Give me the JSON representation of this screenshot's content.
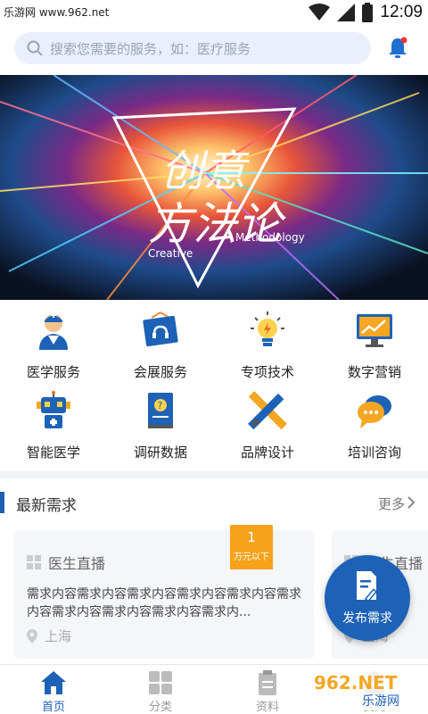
{
  "statusbar": {
    "watermark": "乐游网 www.962.net",
    "time": "12:09"
  },
  "search": {
    "placeholder": "搜索您需要的服务，如：医疗服务"
  },
  "banner": {
    "title_line1": "创意",
    "title_line2": "方法论",
    "sub_left": "Creative",
    "sub_right": "Methodology"
  },
  "categories": [
    {
      "label": "医学服务",
      "icon": "doctor-icon"
    },
    {
      "label": "会展服务",
      "icon": "exhibition-sign-icon"
    },
    {
      "label": "专项技术",
      "icon": "lightbulb-icon"
    },
    {
      "label": "数字营销",
      "icon": "monitor-chart-icon"
    },
    {
      "label": "智能医学",
      "icon": "robot-icon"
    },
    {
      "label": "调研数据",
      "icon": "question-book-icon"
    },
    {
      "label": "品牌设计",
      "icon": "pencil-ruler-icon"
    },
    {
      "label": "培训咨询",
      "icon": "chat-bubbles-icon"
    }
  ],
  "latest": {
    "title": "最新需求",
    "more": "更多",
    "cards": [
      {
        "type": "医生直播",
        "desc": "需求内容需求内容需求内容需求内容需求内容需求内容需求内容需求内容需求内容需求内...",
        "location": "上海",
        "badge_amount": "1",
        "badge_unit": "万元以下"
      },
      {
        "type": "医生直播",
        "location": "上海"
      }
    ]
  },
  "fab": {
    "label": "发布需求"
  },
  "tabs": [
    {
      "label": "首页",
      "icon": "home-icon",
      "active": true
    },
    {
      "label": "分类",
      "icon": "category-grid-icon",
      "active": false
    },
    {
      "label": "资料",
      "icon": "clipboard-icon",
      "active": false
    },
    {
      "label": "我的",
      "icon": "user-icon",
      "active": false
    }
  ],
  "corner_watermark": {
    "text1": "962.NET",
    "text2": "乐游网"
  },
  "colors": {
    "primary": "#1d62b6",
    "badge": "#f7a21b",
    "search_bg": "#e9f0fb",
    "bell": "#1f6fd1"
  }
}
